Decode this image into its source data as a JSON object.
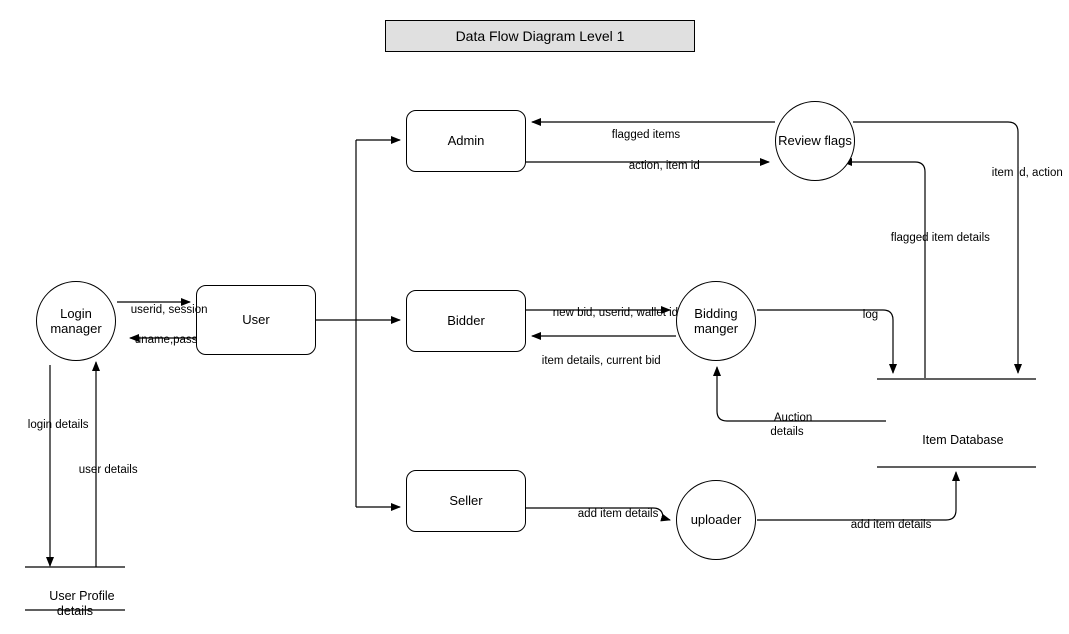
{
  "diagram": {
    "title": "Data Flow Diagram Level 1",
    "type": "data-flow-diagram",
    "level": 1
  },
  "nodes": {
    "login_manager": {
      "label": "Login\nmanager",
      "shape": "circle"
    },
    "user": {
      "label": "User",
      "shape": "rounded-rectangle"
    },
    "admin": {
      "label": "Admin",
      "shape": "rounded-rectangle"
    },
    "bidder": {
      "label": "Bidder",
      "shape": "rounded-rectangle"
    },
    "seller": {
      "label": "Seller",
      "shape": "rounded-rectangle"
    },
    "review_flags": {
      "label": "Review flags",
      "shape": "circle"
    },
    "bidding_manger": {
      "label": "Bidding\nmanger",
      "shape": "circle"
    },
    "uploader": {
      "label": "uploader",
      "shape": "circle"
    }
  },
  "datastores": {
    "user_profile_details": {
      "label": "User Profile\ndetails"
    },
    "item_database": {
      "label": "Item Database"
    }
  },
  "flows": {
    "userid_session": "userid, session",
    "uname_pass": "uname,pass",
    "login_details": "login details",
    "user_details": "user details",
    "flagged_items": "flagged items",
    "action_item_id": "action, item id",
    "item_id_action": "item id, action",
    "flagged_item_details": "flagged item details",
    "new_bid": "new bid, userid, wallet id",
    "item_details_current_bid": "item details, current bid",
    "log": "log",
    "auction_details": "Auction\ndetails",
    "add_item_details_seller": "add item details",
    "add_item_details_uploader": "add item details"
  },
  "colors": {
    "stroke": "#000000",
    "fill": "#ffffff",
    "title_fill": "#e0e0e0"
  }
}
